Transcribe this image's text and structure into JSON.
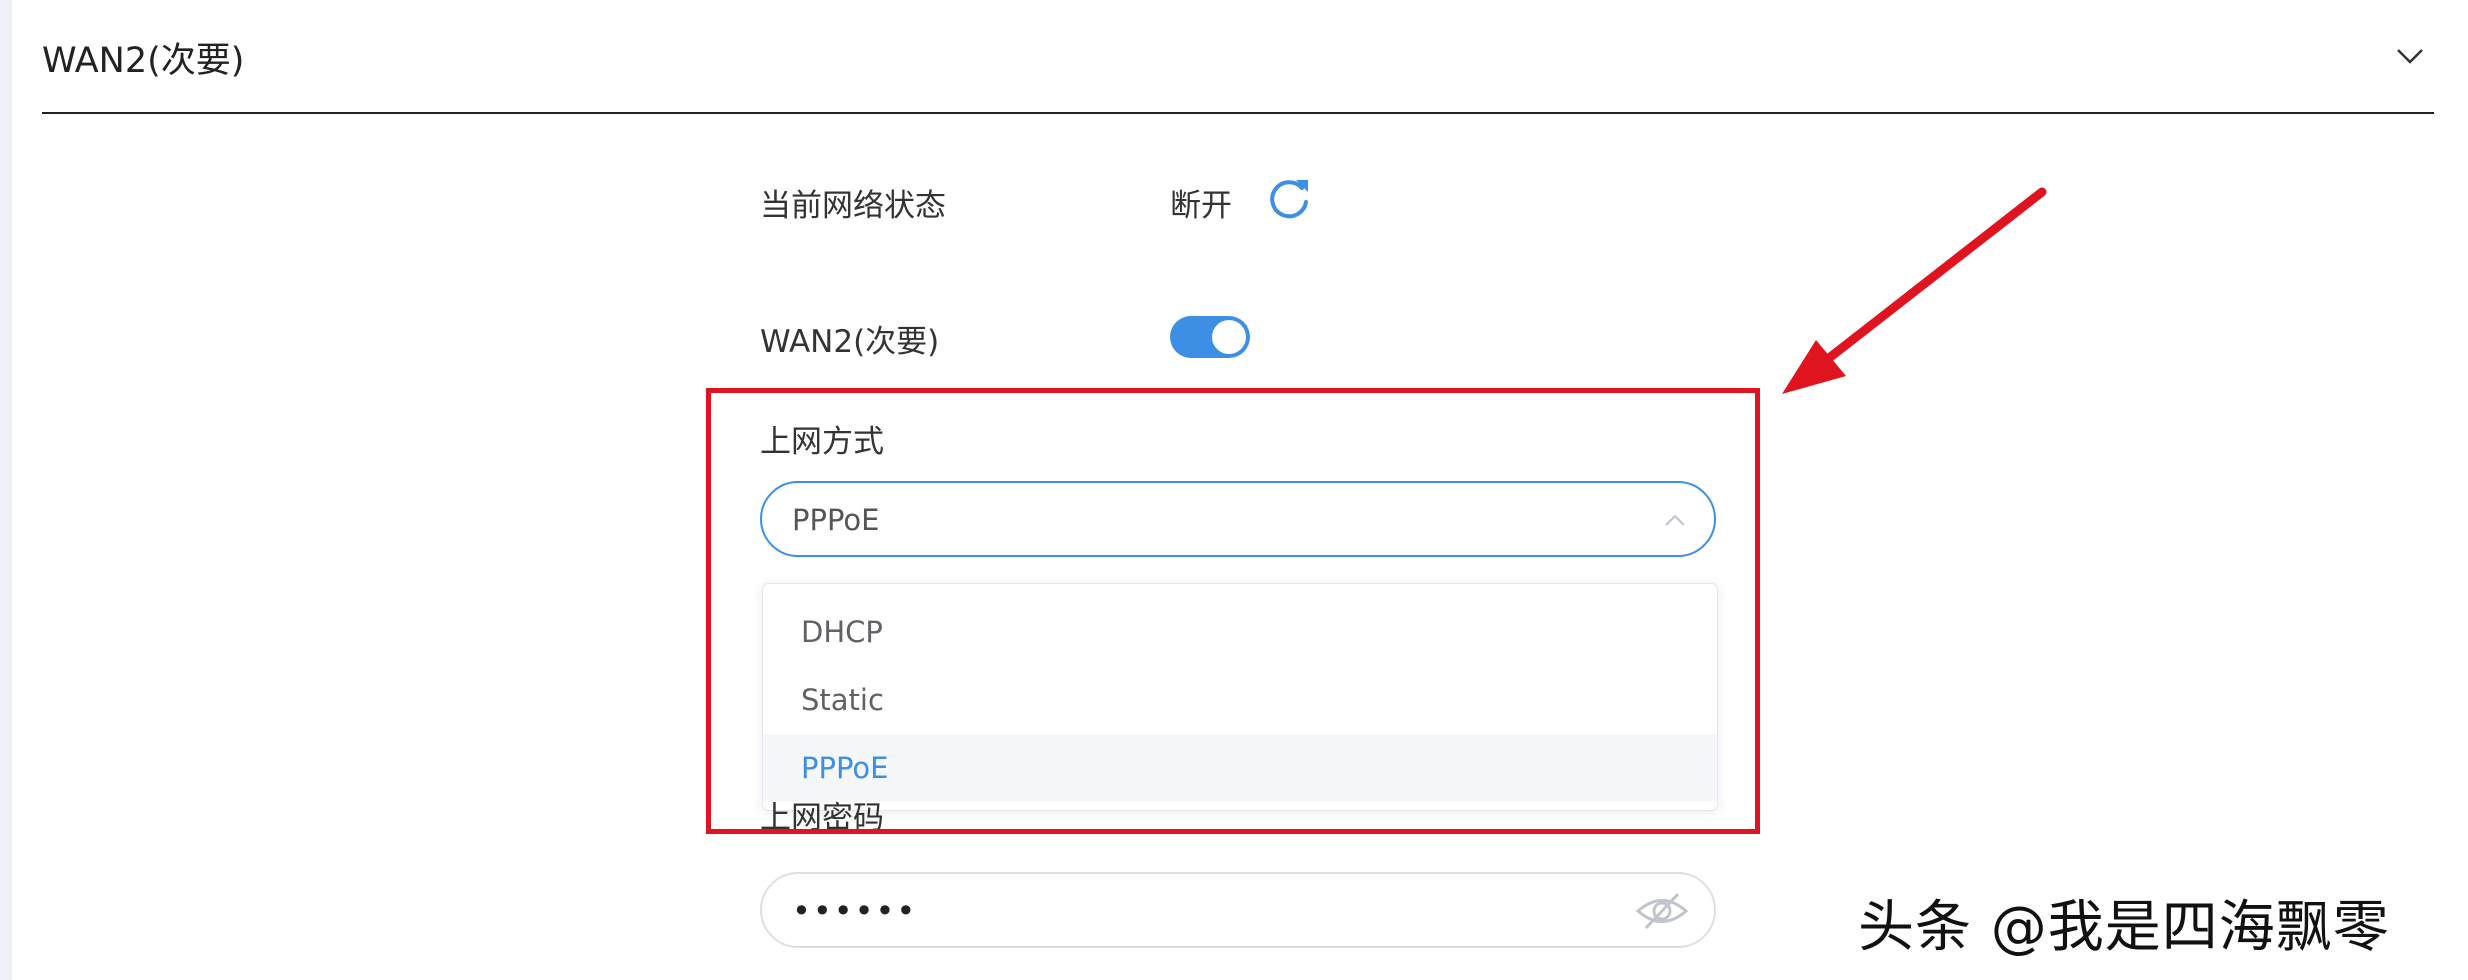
{
  "section": {
    "title": "WAN2(次要)"
  },
  "status": {
    "label": "当前网络状态",
    "value": "断开"
  },
  "wan2_toggle": {
    "label": "WAN2(次要)",
    "enabled": true
  },
  "connection_type": {
    "label": "上网方式",
    "selected": "PPPoE",
    "options": [
      "DHCP",
      "Static",
      "PPPoE"
    ]
  },
  "password": {
    "label": "上网密码",
    "value": "••••••"
  },
  "colors": {
    "accent": "#3d8fe6",
    "annotation_red": "#e0141e"
  },
  "watermark": "头条 @我是四海飘零"
}
